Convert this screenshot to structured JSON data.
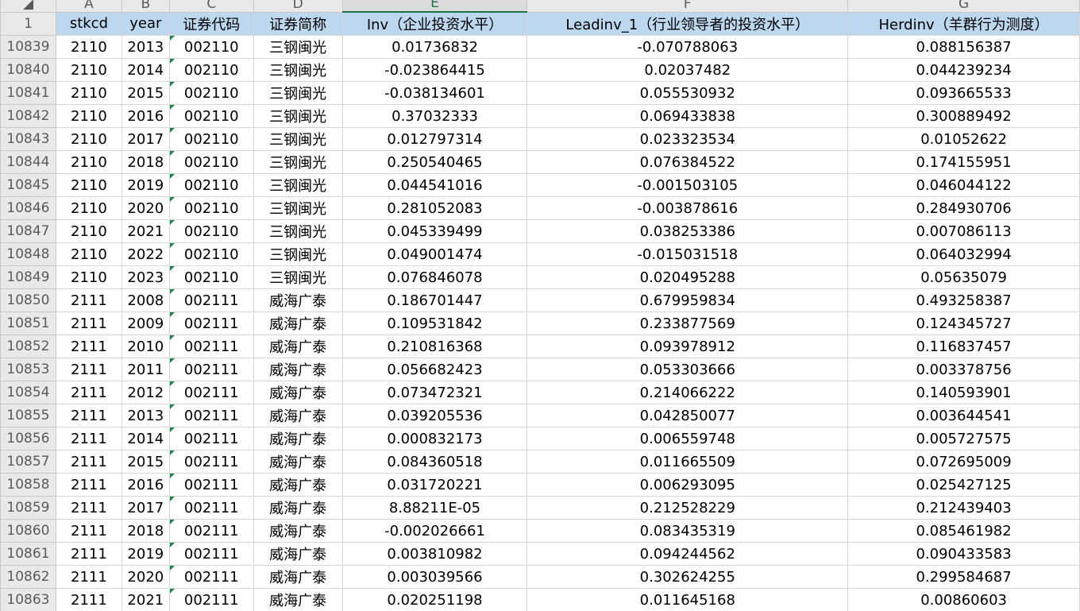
{
  "corner_glyph": "◢",
  "column_letters": [
    "A",
    "B",
    "C",
    "D",
    "E",
    "F",
    "G"
  ],
  "header_row_number": "1",
  "headers": [
    "stkcd",
    "year",
    "证券代码",
    "证券简称",
    "Inv（企业投资水平）",
    "Leadinv_1（行业领导者的投资水平）",
    "Herdinv（羊群行为测度）"
  ],
  "rows": [
    {
      "n": "10839",
      "cells": [
        "2110",
        "2013",
        "002110",
        "三钢闽光",
        "0.01736832",
        "-0.070788063",
        "0.088156387"
      ]
    },
    {
      "n": "10840",
      "cells": [
        "2110",
        "2014",
        "002110",
        "三钢闽光",
        "-0.023864415",
        "0.02037482",
        "0.044239234"
      ]
    },
    {
      "n": "10841",
      "cells": [
        "2110",
        "2015",
        "002110",
        "三钢闽光",
        "-0.038134601",
        "0.055530932",
        "0.093665533"
      ]
    },
    {
      "n": "10842",
      "cells": [
        "2110",
        "2016",
        "002110",
        "三钢闽光",
        "0.37032333",
        "0.069433838",
        "0.300889492"
      ]
    },
    {
      "n": "10843",
      "cells": [
        "2110",
        "2017",
        "002110",
        "三钢闽光",
        "0.012797314",
        "0.023323534",
        "0.01052622"
      ]
    },
    {
      "n": "10844",
      "cells": [
        "2110",
        "2018",
        "002110",
        "三钢闽光",
        "0.250540465",
        "0.076384522",
        "0.174155951"
      ]
    },
    {
      "n": "10845",
      "cells": [
        "2110",
        "2019",
        "002110",
        "三钢闽光",
        "0.044541016",
        "-0.001503105",
        "0.046044122"
      ]
    },
    {
      "n": "10846",
      "cells": [
        "2110",
        "2020",
        "002110",
        "三钢闽光",
        "0.281052083",
        "-0.003878616",
        "0.284930706"
      ]
    },
    {
      "n": "10847",
      "cells": [
        "2110",
        "2021",
        "002110",
        "三钢闽光",
        "0.045339499",
        "0.038253386",
        "0.007086113"
      ]
    },
    {
      "n": "10848",
      "cells": [
        "2110",
        "2022",
        "002110",
        "三钢闽光",
        "0.049001474",
        "-0.015031518",
        "0.064032994"
      ]
    },
    {
      "n": "10849",
      "cells": [
        "2110",
        "2023",
        "002110",
        "三钢闽光",
        "0.076846078",
        "0.020495288",
        "0.05635079"
      ]
    },
    {
      "n": "10850",
      "cells": [
        "2111",
        "2008",
        "002111",
        "威海广泰",
        "0.186701447",
        "0.679959834",
        "0.493258387"
      ]
    },
    {
      "n": "10851",
      "cells": [
        "2111",
        "2009",
        "002111",
        "威海广泰",
        "0.109531842",
        "0.233877569",
        "0.124345727"
      ]
    },
    {
      "n": "10852",
      "cells": [
        "2111",
        "2010",
        "002111",
        "威海广泰",
        "0.210816368",
        "0.093978912",
        "0.116837457"
      ]
    },
    {
      "n": "10853",
      "cells": [
        "2111",
        "2011",
        "002111",
        "威海广泰",
        "0.056682423",
        "0.053303666",
        "0.003378756"
      ]
    },
    {
      "n": "10854",
      "cells": [
        "2111",
        "2012",
        "002111",
        "威海广泰",
        "0.073472321",
        "0.214066222",
        "0.140593901"
      ]
    },
    {
      "n": "10855",
      "cells": [
        "2111",
        "2013",
        "002111",
        "威海广泰",
        "0.039205536",
        "0.042850077",
        "0.003644541"
      ]
    },
    {
      "n": "10856",
      "cells": [
        "2111",
        "2014",
        "002111",
        "威海广泰",
        "0.000832173",
        "0.006559748",
        "0.005727575"
      ]
    },
    {
      "n": "10857",
      "cells": [
        "2111",
        "2015",
        "002111",
        "威海广泰",
        "0.084360518",
        "0.011665509",
        "0.072695009"
      ]
    },
    {
      "n": "10858",
      "cells": [
        "2111",
        "2016",
        "002111",
        "威海广泰",
        "0.031720221",
        "0.006293095",
        "0.025427125"
      ]
    },
    {
      "n": "10859",
      "cells": [
        "2111",
        "2017",
        "002111",
        "威海广泰",
        "8.88211E-05",
        "0.212528229",
        "0.212439403"
      ]
    },
    {
      "n": "10860",
      "cells": [
        "2111",
        "2018",
        "002111",
        "威海广泰",
        "-0.002026661",
        "0.083435319",
        "0.085461982"
      ]
    },
    {
      "n": "10861",
      "cells": [
        "2111",
        "2019",
        "002111",
        "威海广泰",
        "0.003810982",
        "0.094244562",
        "0.090433583"
      ]
    },
    {
      "n": "10862",
      "cells": [
        "2111",
        "2020",
        "002111",
        "威海广泰",
        "0.003039566",
        "0.302624255",
        "0.299584687"
      ]
    },
    {
      "n": "10863",
      "cells": [
        "2111",
        "2021",
        "002111",
        "威海广泰",
        "0.020251198",
        "0.011645168",
        "0.00860603"
      ]
    }
  ]
}
